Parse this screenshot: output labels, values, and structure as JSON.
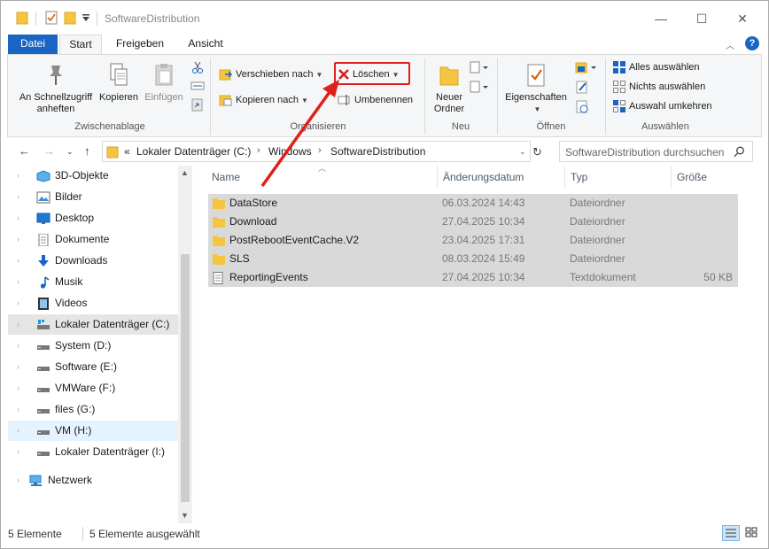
{
  "window": {
    "title": "SoftwareDistribution",
    "controls": {
      "minimize": "—",
      "maximize": "☐",
      "close": "✕"
    }
  },
  "ribbon_tabs": {
    "file": "Datei",
    "start": "Start",
    "share": "Freigeben",
    "view": "Ansicht"
  },
  "ribbon": {
    "clipboard": {
      "label": "Zwischenablage",
      "pin_line1": "An Schnellzugriff",
      "pin_line2": "anheften",
      "copy": "Kopieren",
      "paste": "Einfügen"
    },
    "organize": {
      "label": "Organisieren",
      "move_to": "Verschieben nach",
      "copy_to": "Kopieren nach",
      "delete": "Löschen",
      "rename": "Umbenennen"
    },
    "new": {
      "label": "Neu",
      "new_folder_line1": "Neuer",
      "new_folder_line2": "Ordner"
    },
    "open": {
      "label": "Öffnen",
      "properties": "Eigenschaften"
    },
    "select": {
      "label": "Auswählen",
      "select_all": "Alles auswählen",
      "select_none": "Nichts auswählen",
      "invert": "Auswahl umkehren"
    }
  },
  "address": {
    "prefix": "«",
    "crumbs": [
      "Lokaler Datenträger (C:)",
      "Windows",
      "SoftwareDistribution"
    ],
    "search_placeholder": "SoftwareDistribution durchsuchen"
  },
  "nav_tree": [
    {
      "label": "3D-Objekte",
      "icon": "3d-objects-icon"
    },
    {
      "label": "Bilder",
      "icon": "pictures-icon"
    },
    {
      "label": "Desktop",
      "icon": "desktop-icon"
    },
    {
      "label": "Dokumente",
      "icon": "documents-icon"
    },
    {
      "label": "Downloads",
      "icon": "downloads-icon"
    },
    {
      "label": "Musik",
      "icon": "music-icon"
    },
    {
      "label": "Videos",
      "icon": "videos-icon"
    },
    {
      "label": "Lokaler Datenträger (C:)",
      "icon": "system-drive-icon"
    },
    {
      "label": "System (D:)",
      "icon": "drive-icon"
    },
    {
      "label": "Software (E:)",
      "icon": "drive-icon"
    },
    {
      "label": "VMWare (F:)",
      "icon": "drive-icon"
    },
    {
      "label": "files (G:)",
      "icon": "drive-icon"
    },
    {
      "label": "VM (H:)",
      "icon": "drive-icon"
    },
    {
      "label": "Lokaler Datenträger (I:)",
      "icon": "drive-icon"
    },
    {
      "label": "Netzwerk",
      "icon": "network-icon"
    }
  ],
  "columns": {
    "name": "Name",
    "date": "Änderungsdatum",
    "type": "Typ",
    "size": "Größe"
  },
  "files": [
    {
      "name": "DataStore",
      "date": "06.03.2024 14:43",
      "type": "Dateiordner",
      "size": "",
      "icon": "folder-icon"
    },
    {
      "name": "Download",
      "date": "27.04.2025 10:34",
      "type": "Dateiordner",
      "size": "",
      "icon": "folder-icon"
    },
    {
      "name": "PostRebootEventCache.V2",
      "date": "23.04.2025 17:31",
      "type": "Dateiordner",
      "size": "",
      "icon": "folder-icon"
    },
    {
      "name": "SLS",
      "date": "08.03.2024 15:49",
      "type": "Dateiordner",
      "size": "",
      "icon": "folder-icon"
    },
    {
      "name": "ReportingEvents",
      "date": "27.04.2025 10:34",
      "type": "Textdokument",
      "size": "50 KB",
      "icon": "text-file-icon"
    }
  ],
  "status": {
    "count": "5 Elemente",
    "selected": "5 Elemente ausgewählt"
  },
  "colors": {
    "accent": "#1a64c4",
    "highlight": "#e0201a",
    "folder": "#f5c542"
  }
}
